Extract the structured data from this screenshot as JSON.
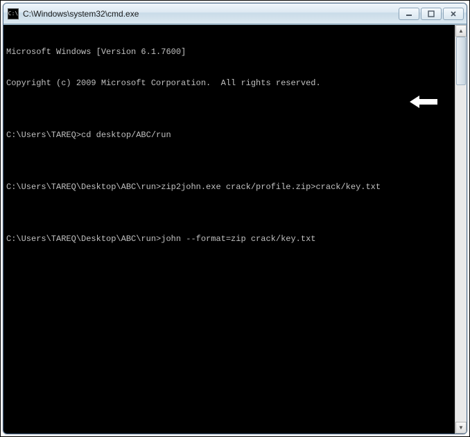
{
  "window": {
    "title": "C:\\Windows\\system32\\cmd.exe",
    "icon_label": "C:\\"
  },
  "controls": {
    "minimize_glyph": "—",
    "maximize_glyph": "☐",
    "close_glyph": "✕"
  },
  "scrollbar": {
    "up_glyph": "▲",
    "down_glyph": "▼"
  },
  "terminal": {
    "lines": [
      "Microsoft Windows [Version 6.1.7600]",
      "Copyright (c) 2009 Microsoft Corporation.  All rights reserved.",
      "",
      "C:\\Users\\TAREQ>cd desktop/ABC/run",
      "",
      "C:\\Users\\TAREQ\\Desktop\\ABC\\run>zip2john.exe crack/profile.zip>crack/key.txt",
      "",
      "C:\\Users\\TAREQ\\Desktop\\ABC\\run>john --format=zip crack/key.txt"
    ]
  },
  "annotation": {
    "arrow_color": "#ffffff"
  }
}
